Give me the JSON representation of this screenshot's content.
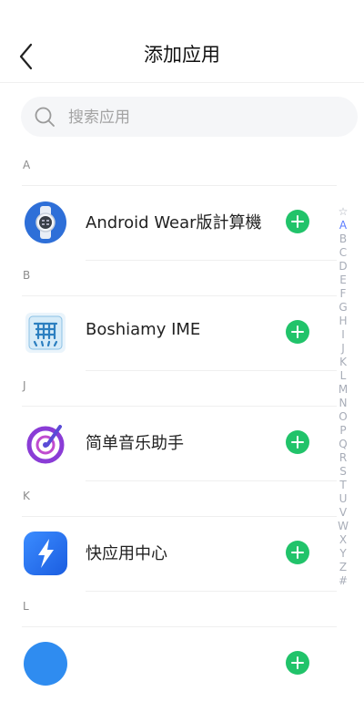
{
  "header": {
    "title": "添加应用"
  },
  "search": {
    "placeholder": "搜索应用"
  },
  "sections": [
    {
      "letter": "A",
      "apps": [
        {
          "name": "Android Wear版計算機",
          "icon": "watch-calculator-icon"
        }
      ]
    },
    {
      "letter": "B",
      "apps": [
        {
          "name": "Boshiamy IME",
          "icon": "boshiamy-ime-icon"
        }
      ]
    },
    {
      "letter": "J",
      "apps": [
        {
          "name": "简单音乐助手",
          "icon": "music-disc-icon"
        }
      ]
    },
    {
      "letter": "K",
      "apps": [
        {
          "name": "快应用中心",
          "icon": "quick-app-center-icon"
        }
      ]
    },
    {
      "letter": "L",
      "apps": []
    }
  ],
  "index_bar": [
    "☆",
    "A",
    "B",
    "C",
    "D",
    "E",
    "F",
    "G",
    "H",
    "I",
    "J",
    "K",
    "L",
    "M",
    "N",
    "O",
    "P",
    "Q",
    "R",
    "S",
    "T",
    "U",
    "V",
    "W",
    "X",
    "Y",
    "Z",
    "#"
  ],
  "index_active": "A",
  "colors": {
    "add": "#21c36a",
    "index_active": "#5b7cff"
  }
}
